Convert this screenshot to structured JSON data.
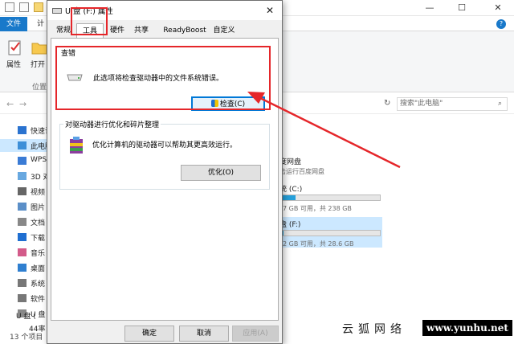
{
  "explorer": {
    "file_tab": "文件",
    "second_tab": "计",
    "ribbon": {
      "properties_label": "属性",
      "open_label": "打开",
      "group_location": "位置"
    },
    "search_placeholder": "搜索\"此电脑\"",
    "nav": {
      "items": [
        {
          "label": "快速访",
          "icon": "star-icon"
        },
        {
          "label": "此电脑",
          "icon": "computer-icon",
          "active": true
        },
        {
          "label": "WPS",
          "icon": "cloud-icon"
        },
        {
          "label": "3D 对",
          "icon": "cube-icon"
        },
        {
          "label": "视频",
          "icon": "video-icon"
        },
        {
          "label": "图片",
          "icon": "picture-icon"
        },
        {
          "label": "文档",
          "icon": "document-icon"
        },
        {
          "label": "下载",
          "icon": "download-icon"
        },
        {
          "label": "音乐",
          "icon": "music-icon"
        },
        {
          "label": "桌面",
          "icon": "desktop-icon"
        },
        {
          "label": "系统",
          "icon": "drive-icon"
        },
        {
          "label": "软件",
          "icon": "drive-icon"
        },
        {
          "label": "U 盘",
          "icon": "usb-icon"
        }
      ],
      "usb_tree_label": "U 盘 (",
      "usb_child_label": "44率"
    },
    "status": "13 个项目",
    "drives": {
      "cloud_name": "度网盘",
      "cloud_sub": "击运行百度网盘",
      "c_name": "统 (C:)",
      "c_free": "7 GB 可用，共 238 GB",
      "c_usage": 0.15,
      "f_name": "盘 (F:)",
      "f_free": "2 GB 可用，共 28.6 GB",
      "f_usage": 0.03
    }
  },
  "dialog": {
    "title": "U 盘 (F:) 属性",
    "close_glyph": "✕",
    "tabs": [
      "常规",
      "工具",
      "硬件",
      "共享",
      "ReadyBoost",
      "自定义"
    ],
    "selected_tab": "工具",
    "error_check": {
      "title": "查错",
      "text": "此选项将检查驱动器中的文件系统错误。",
      "button": "检查(C)"
    },
    "optimize": {
      "title": "对驱动器进行优化和碎片整理",
      "text": "优化计算机的驱动器可以帮助其更高效运行。",
      "button": "优化(O)"
    },
    "buttons": {
      "ok": "确定",
      "cancel": "取消",
      "apply": "应用(A)"
    }
  },
  "watermark": {
    "brand": "云狐网络",
    "url": "www.yunhu.net"
  },
  "colors": {
    "accent": "#0078d7",
    "file_tab": "#1979ca",
    "annotation": "#e5262a",
    "drive_fill": "#26a0da"
  }
}
